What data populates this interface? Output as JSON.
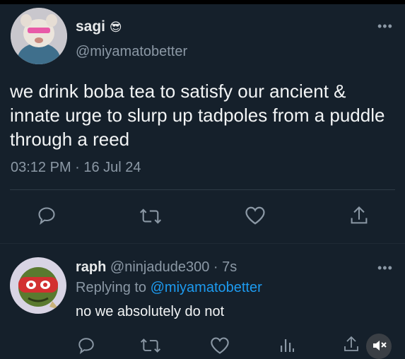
{
  "tweet": {
    "author_name": "sagi",
    "author_emoji": "😎",
    "handle": "@miyamatobetter",
    "text": "we drink boba tea to satisfy our ancient & innate urge to slurp up tadpoles from a puddle through a reed",
    "timestamp": "03:12 PM · 16 Jul 24",
    "more": "•••"
  },
  "reply": {
    "author_name": "raph",
    "handle_time": "@ninjadude300 · 7s",
    "replying_prefix": "Replying to",
    "replying_handle": "@miyamatobetter",
    "text": "no we absolutely do not",
    "more": "•••"
  },
  "icons": {
    "reply": "reply-icon",
    "retweet": "retweet-icon",
    "like": "heart-icon",
    "share": "share-icon",
    "views": "views-icon",
    "mute": "mute-icon"
  },
  "colors": {
    "background": "#15202b",
    "text": "#e7e9ea",
    "muted": "#8b98a5",
    "link": "#1d9bf0"
  }
}
